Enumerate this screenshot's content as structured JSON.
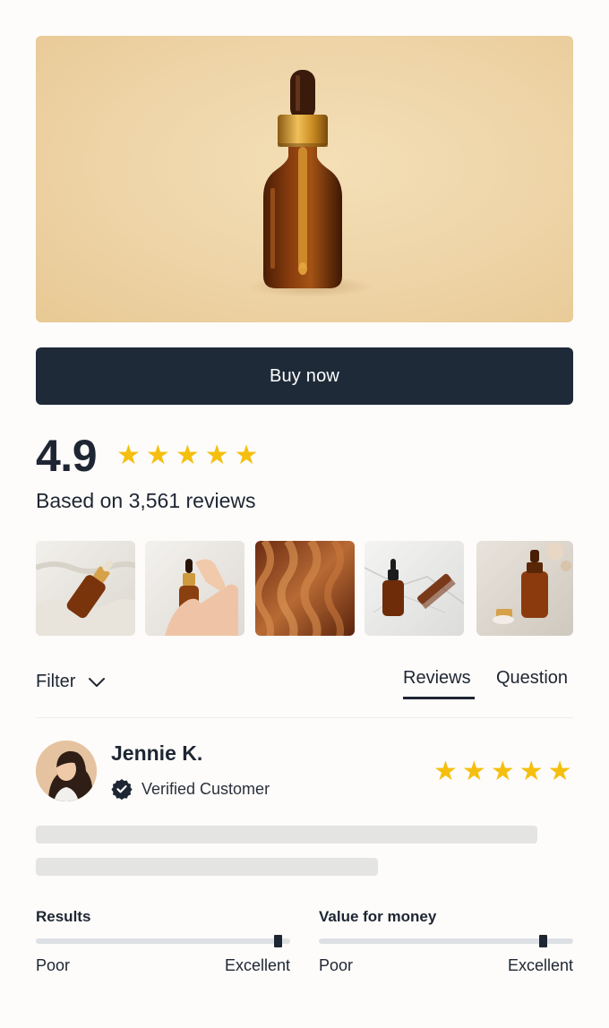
{
  "product": {
    "image_alt": "amber dropper bottle serum",
    "buy_label": "Buy now"
  },
  "rating": {
    "score": "4.9",
    "stars": 5,
    "based_on": "Based on 3,561 reviews"
  },
  "gallery": [
    {
      "name": "bottle-on-towel"
    },
    {
      "name": "hand-holding-bottle"
    },
    {
      "name": "wavy-hair"
    },
    {
      "name": "bottle-and-comb-on-marble"
    },
    {
      "name": "bottle-with-flowers"
    }
  ],
  "filters": {
    "label": "Filter",
    "icon": "chevron-down-icon"
  },
  "tabs": [
    {
      "label": "Reviews",
      "active": true
    },
    {
      "label": "Question",
      "active": false
    }
  ],
  "review": {
    "author": "Jennie K.",
    "badge": "Verified Customer",
    "badge_icon": "verified-check-icon",
    "stars": 5
  },
  "metrics": [
    {
      "title": "Results",
      "min_label": "Poor",
      "max_label": "Excellent",
      "value": 0.95
    },
    {
      "title": "Value for money",
      "min_label": "Poor",
      "max_label": "Excellent",
      "value": 0.88
    }
  ],
  "colors": {
    "accent_star": "#f5bf0f",
    "button_bg": "#1e2a38",
    "text_primary": "#1e2633"
  }
}
